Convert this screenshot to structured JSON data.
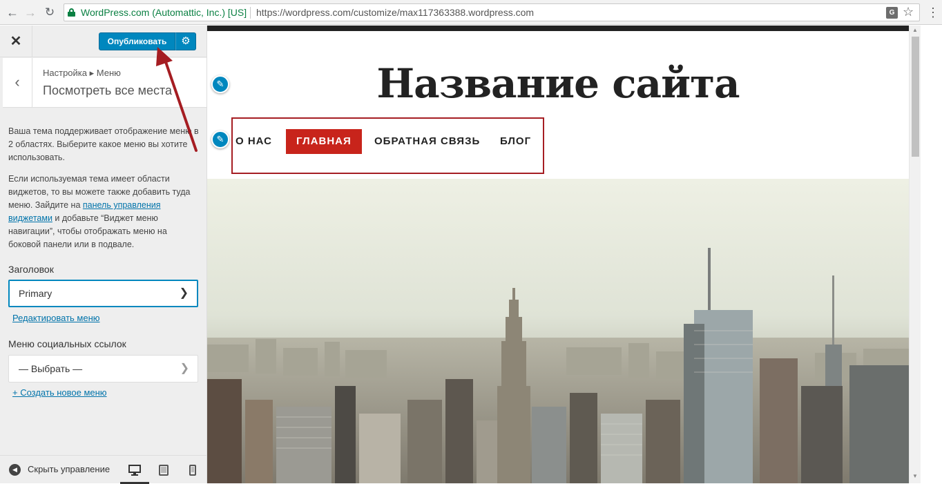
{
  "browser": {
    "org": "WordPress.com (Automattic, Inc.) [US]",
    "url": "https://wordpress.com/customize/max117363388.wordpress.com",
    "translate_glyph": "G"
  },
  "sidebar": {
    "publish_label": "Опубликовать",
    "breadcrumb": "Настройка ▸ Меню",
    "section_title": "Посмотреть все места",
    "desc1": "Ваша тема поддерживает отображение меню в 2 областях. Выберите какое меню вы хотите использовать.",
    "desc2_pre": "Если используемая тема имеет области виджетов, то вы можете также добавить туда меню. Зайдите на ",
    "desc2_link": "панель управления виджетами",
    "desc2_post": " и добавьте “Виджет меню навигации”, чтобы отображать меню на боковой панели или в подвале.",
    "header_label": "Заголовок",
    "header_select": "Primary",
    "edit_menu_link": "Редактировать меню",
    "social_label": "Меню социальных ссылок",
    "social_select": "— Выбрать —",
    "create_menu_link": "+ Создать новое меню",
    "hide_controls": "Скрыть управление"
  },
  "preview": {
    "site_title": "Название сайта",
    "menu": [
      "О НАС",
      "ГЛАВНАЯ",
      "ОБРАТНАЯ СВЯЗЬ",
      "БЛОГ"
    ],
    "active_menu_item": "ГЛАВНАЯ"
  },
  "colors": {
    "publish": "#0087be",
    "menu_active": "#c8241b",
    "annotation": "#a51d22"
  },
  "icons": [
    "back-arrow-icon",
    "forward-arrow-icon",
    "reload-icon",
    "lock-icon",
    "translate-icon",
    "star-icon",
    "menu-dots-icon",
    "close-icon",
    "gear-icon",
    "chevron-left-icon",
    "chevron-down-icon",
    "hide-controls-icon",
    "desktop-icon",
    "tablet-icon",
    "mobile-icon",
    "pencil-icon"
  ]
}
